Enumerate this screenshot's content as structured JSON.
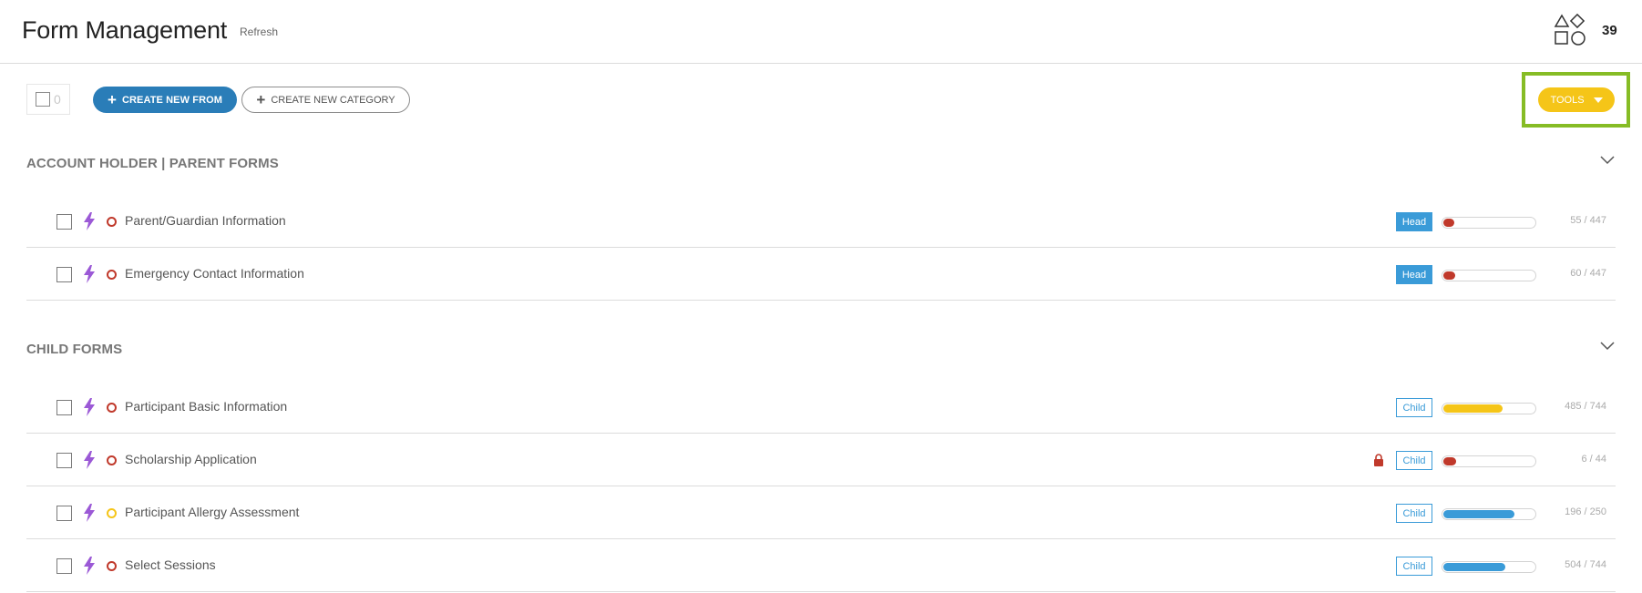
{
  "header": {
    "title": "Form Management",
    "refresh_label": "Refresh",
    "count": "39"
  },
  "toolbar": {
    "selected_count": "0",
    "create_form_label": "CREATE NEW FROM",
    "create_category_label": "CREATE NEW CATEGORY",
    "tools_label": "TOOLS"
  },
  "colors": {
    "primary_blue": "#2a7db8",
    "badge_blue": "#3a9bd8",
    "tools_yellow": "#f5c518",
    "highlight_green": "#86bc25",
    "status_red": "#c0392b",
    "bolt_purple": "#9b59d6"
  },
  "sections": [
    {
      "title": "ACCOUNT HOLDER | PARENT FORMS",
      "rows": [
        {
          "name": "Parent/Guardian Information",
          "status": "red",
          "locked": false,
          "type": "Head",
          "progress": 0.12,
          "progress_color": "#c0392b",
          "count": "55 / 447"
        },
        {
          "name": "Emergency Contact Information",
          "status": "red",
          "locked": false,
          "type": "Head",
          "progress": 0.13,
          "progress_color": "#c0392b",
          "count": "60 / 447"
        }
      ]
    },
    {
      "title": "CHILD FORMS",
      "rows": [
        {
          "name": "Participant Basic Information",
          "status": "red",
          "locked": false,
          "type": "Child",
          "progress": 0.65,
          "progress_color": "#f5c518",
          "count": "485 / 744"
        },
        {
          "name": "Scholarship Application",
          "status": "red",
          "locked": true,
          "type": "Child",
          "progress": 0.14,
          "progress_color": "#c0392b",
          "count": "6 / 44"
        },
        {
          "name": "Participant Allergy Assessment",
          "status": "yellow",
          "locked": false,
          "type": "Child",
          "progress": 0.78,
          "progress_color": "#3a9bd8",
          "count": "196 / 250"
        },
        {
          "name": "Select Sessions",
          "status": "red",
          "locked": false,
          "type": "Child",
          "progress": 0.68,
          "progress_color": "#3a9bd8",
          "count": "504 / 744"
        }
      ]
    }
  ]
}
